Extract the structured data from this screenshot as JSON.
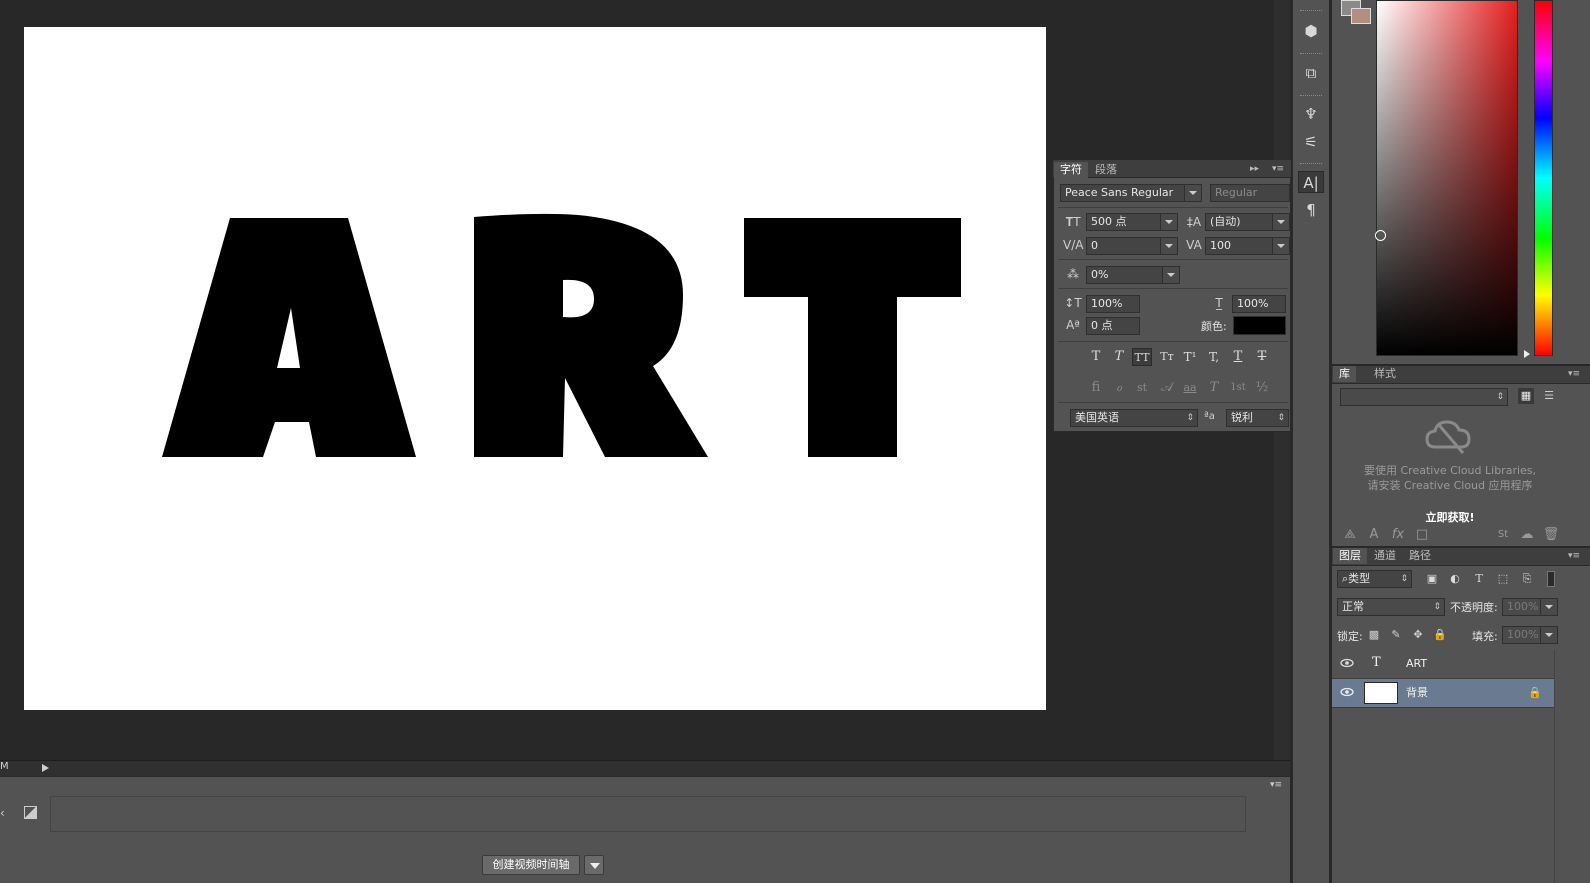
{
  "document": {
    "text_layer": "ART"
  },
  "status": {
    "text": "M"
  },
  "timeline": {
    "create_button_label": "创建视频时间轴"
  },
  "character_panel": {
    "tabs": [
      "字符",
      "段落"
    ],
    "font_family": "Peace Sans Regular",
    "font_style": "Regular",
    "font_size": "500 点",
    "leading": "(自动)",
    "kerning": "0",
    "tracking": "100",
    "tsume": "0%",
    "vertical_scale": "100%",
    "horizontal_scale": "100%",
    "baseline_shift": "0 点",
    "color_label": "颜色:",
    "color": "#000000",
    "type_buttons": [
      "T",
      "T",
      "TT",
      "Tт",
      "T¹",
      "T,",
      "T",
      "T"
    ],
    "opentype_buttons": [
      "ﬁ",
      "ℴ",
      "st",
      "𝒜",
      "aa",
      "T",
      "1st",
      "½"
    ],
    "language": "美国英语",
    "aa_label": "ªa",
    "antialias": "锐利"
  },
  "color_panel": {
    "fg_color": "#8a8a8a",
    "bg_color": "#b09080",
    "field_hue": "#e61e1e"
  },
  "library_panel": {
    "tabs": [
      "库",
      "样式"
    ],
    "message_line1": "要使用 Creative Cloud Libraries,",
    "message_line2": "请安装 Creative Cloud 应用程序",
    "cta": "立即获取!"
  },
  "layers_panel": {
    "tabs": [
      "图层",
      "通道",
      "路径"
    ],
    "filter_kind": "类型",
    "blend_mode": "正常",
    "opacity_label": "不透明度:",
    "opacity_value": "100%",
    "lock_label": "锁定:",
    "fill_label": "填充:",
    "fill_value": "100%",
    "layers": [
      {
        "name": "ART",
        "type": "text",
        "glyph": "T",
        "selected": false
      },
      {
        "name": "背景",
        "type": "background",
        "selected": true
      }
    ]
  }
}
